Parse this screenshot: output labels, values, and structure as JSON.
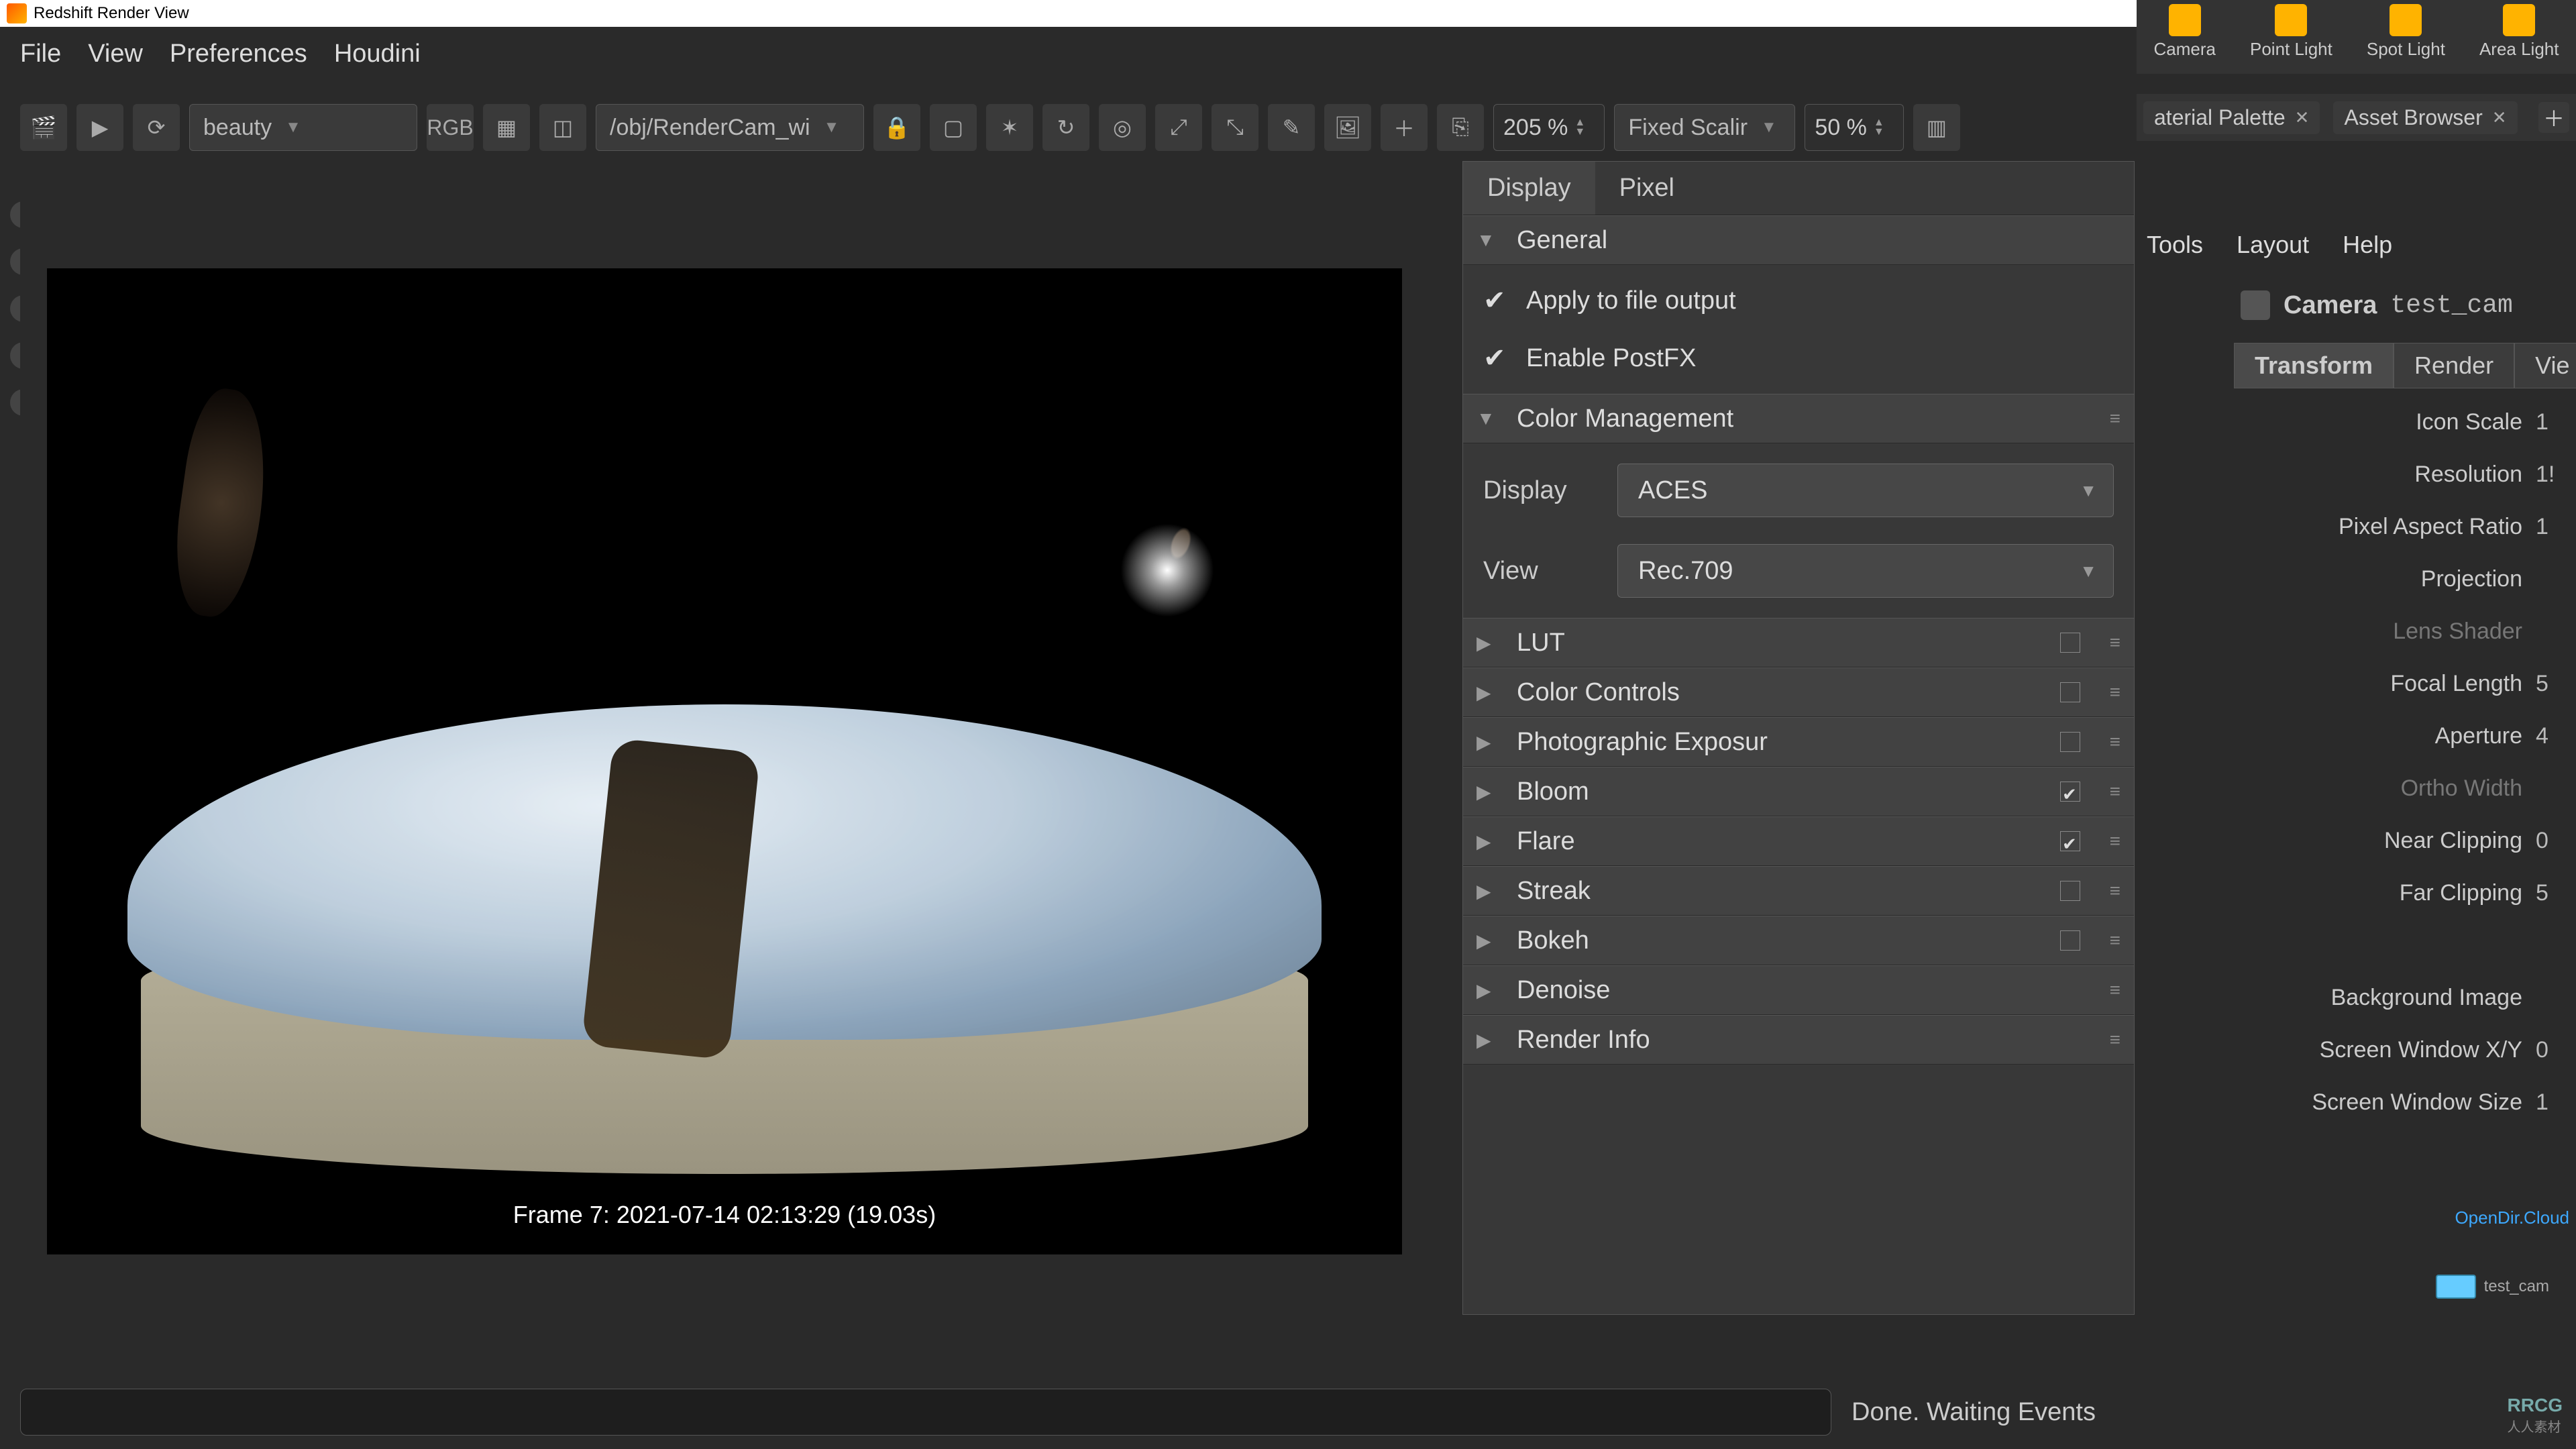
{
  "window": {
    "title": "Redshift Render View"
  },
  "menu": [
    "File",
    "View",
    "Preferences",
    "Houdini"
  ],
  "toolbar": {
    "aov": "beauty",
    "camera_path": "/obj/RenderCam_wi",
    "zoom": "205 %",
    "scale_mode": "Fixed Scalir",
    "scale_pct": "50 %"
  },
  "frame_info": "Frame 7: 2021-07-14 02:13:29 (19.03s)",
  "display_panel": {
    "tabs": [
      "Display",
      "Pixel"
    ],
    "general": "General",
    "apply_file_output": "Apply to file output",
    "enable_postfx": "Enable PostFX",
    "color_mgmt": "Color Management",
    "display_label": "Display",
    "display_value": "ACES",
    "view_label": "View",
    "view_value": "Rec.709",
    "sections": [
      {
        "name": "LUT",
        "checked": false
      },
      {
        "name": "Color Controls",
        "checked": false
      },
      {
        "name": "Photographic Exposur",
        "checked": false
      },
      {
        "name": "Bloom",
        "checked": true
      },
      {
        "name": "Flare",
        "checked": true
      },
      {
        "name": "Streak",
        "checked": false
      },
      {
        "name": "Bokeh",
        "checked": false
      },
      {
        "name": "Denoise",
        "checked": null
      },
      {
        "name": "Render Info",
        "checked": null
      }
    ]
  },
  "shelf": [
    {
      "label": "Camera"
    },
    {
      "label": "Point Light"
    },
    {
      "label": "Spot Light"
    },
    {
      "label": "Area Light"
    }
  ],
  "browser_tabs": [
    {
      "label": "aterial Palette"
    },
    {
      "label": "Asset Browser"
    }
  ],
  "helpbar": [
    "Tools",
    "Layout",
    "Help"
  ],
  "cam_node": {
    "type": "Camera",
    "name": "test_cam"
  },
  "cam_tabs": [
    "Transform",
    "Render",
    "Vie"
  ],
  "cam_props": [
    {
      "label": "Icon Scale",
      "value": "1"
    },
    {
      "label": "Resolution",
      "value": "1!"
    },
    {
      "label": "Pixel Aspect Ratio",
      "value": "1"
    },
    {
      "label": "Projection",
      "value": ""
    },
    {
      "label": "Lens Shader",
      "value": "",
      "dim": true
    },
    {
      "label": "Focal Length",
      "value": "5"
    },
    {
      "label": "Aperture",
      "value": "4"
    },
    {
      "label": "Ortho Width",
      "value": "",
      "dim": true
    },
    {
      "label": "Near Clipping",
      "value": "0"
    },
    {
      "label": "Far Clipping",
      "value": "5"
    },
    {
      "label": "",
      "value": ""
    },
    {
      "label": "Background Image",
      "value": ""
    },
    {
      "label": "Screen Window X/Y",
      "value": "0"
    },
    {
      "label": "Screen Window Size",
      "value": "1"
    }
  ],
  "status": "Done. Waiting Events",
  "watermark": "OpenDir.Cloud",
  "mini_cam": "test_cam",
  "logo_main": "RRCG",
  "logo_sub": "人人素材"
}
